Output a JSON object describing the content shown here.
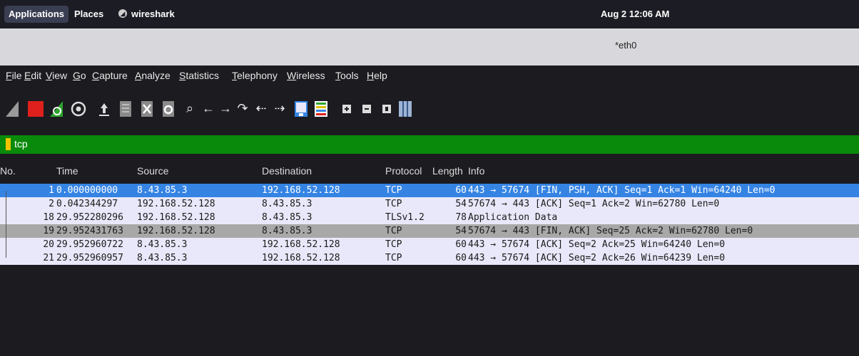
{
  "topbar": {
    "applications": "Applications",
    "places": "Places",
    "app_name": "wireshark",
    "clock": "Aug 2  12:06 AM"
  },
  "window": {
    "title": "*eth0"
  },
  "menu": [
    "File",
    "Edit",
    "View",
    "Go",
    "Capture",
    "Analyze",
    "Statistics",
    "Telephony",
    "Wireless",
    "Tools",
    "Help"
  ],
  "toolbar_icons": [
    "shark-fin-start-icon",
    "stop-capture-icon",
    "restart-capture-icon",
    "capture-options-icon",
    "open-file-icon",
    "save-file-icon",
    "close-file-icon",
    "reload-file-icon",
    "find-packet-icon",
    "go-back-icon",
    "go-forward-icon",
    "go-to-packet-icon",
    "first-packet-icon",
    "last-packet-icon",
    "autoscroll-icon",
    "colorize-icon",
    "zoom-in-icon",
    "zoom-out-icon",
    "normal-size-icon",
    "resize-columns-icon"
  ],
  "filter": {
    "value": "tcp"
  },
  "columns": [
    "No.",
    "Time",
    "Source",
    "Destination",
    "Protocol",
    "Length",
    "Info"
  ],
  "packets": [
    {
      "no": "1",
      "time": "0.000000000",
      "src": "8.43.85.3",
      "dst": "192.168.52.128",
      "proto": "TCP",
      "len": "60",
      "info": "443 → 57674 [FIN, PSH, ACK] Seq=1 Ack=1 Win=64240 Len=0"
    },
    {
      "no": "2",
      "time": "0.042344297",
      "src": "192.168.52.128",
      "dst": "8.43.85.3",
      "proto": "TCP",
      "len": "54",
      "info": "57674 → 443 [ACK] Seq=1 Ack=2 Win=62780 Len=0"
    },
    {
      "no": "18",
      "time": "29.952280296",
      "src": "192.168.52.128",
      "dst": "8.43.85.3",
      "proto": "TLSv1.2",
      "len": "78",
      "info": "Application Data"
    },
    {
      "no": "19",
      "time": "29.952431763",
      "src": "192.168.52.128",
      "dst": "8.43.85.3",
      "proto": "TCP",
      "len": "54",
      "info": "57674 → 443 [FIN, ACK] Seq=25 Ack=2 Win=62780 Len=0"
    },
    {
      "no": "20",
      "time": "29.952960722",
      "src": "8.43.85.3",
      "dst": "192.168.52.128",
      "proto": "TCP",
      "len": "60",
      "info": "443 → 57674 [ACK] Seq=2 Ack=25 Win=64240 Len=0"
    },
    {
      "no": "21",
      "time": "29.952960957",
      "src": "8.43.85.3",
      "dst": "192.168.52.128",
      "proto": "TCP",
      "len": "60",
      "info": "443 → 57674 [ACK] Seq=2 Ack=26 Win=64239 Len=0"
    }
  ],
  "colors": {
    "filter_bar": "#0a8a0a",
    "selected_row": "#3584e4",
    "highlight_row": "#a8a8a8",
    "row_bg": "#e9e8fa"
  }
}
